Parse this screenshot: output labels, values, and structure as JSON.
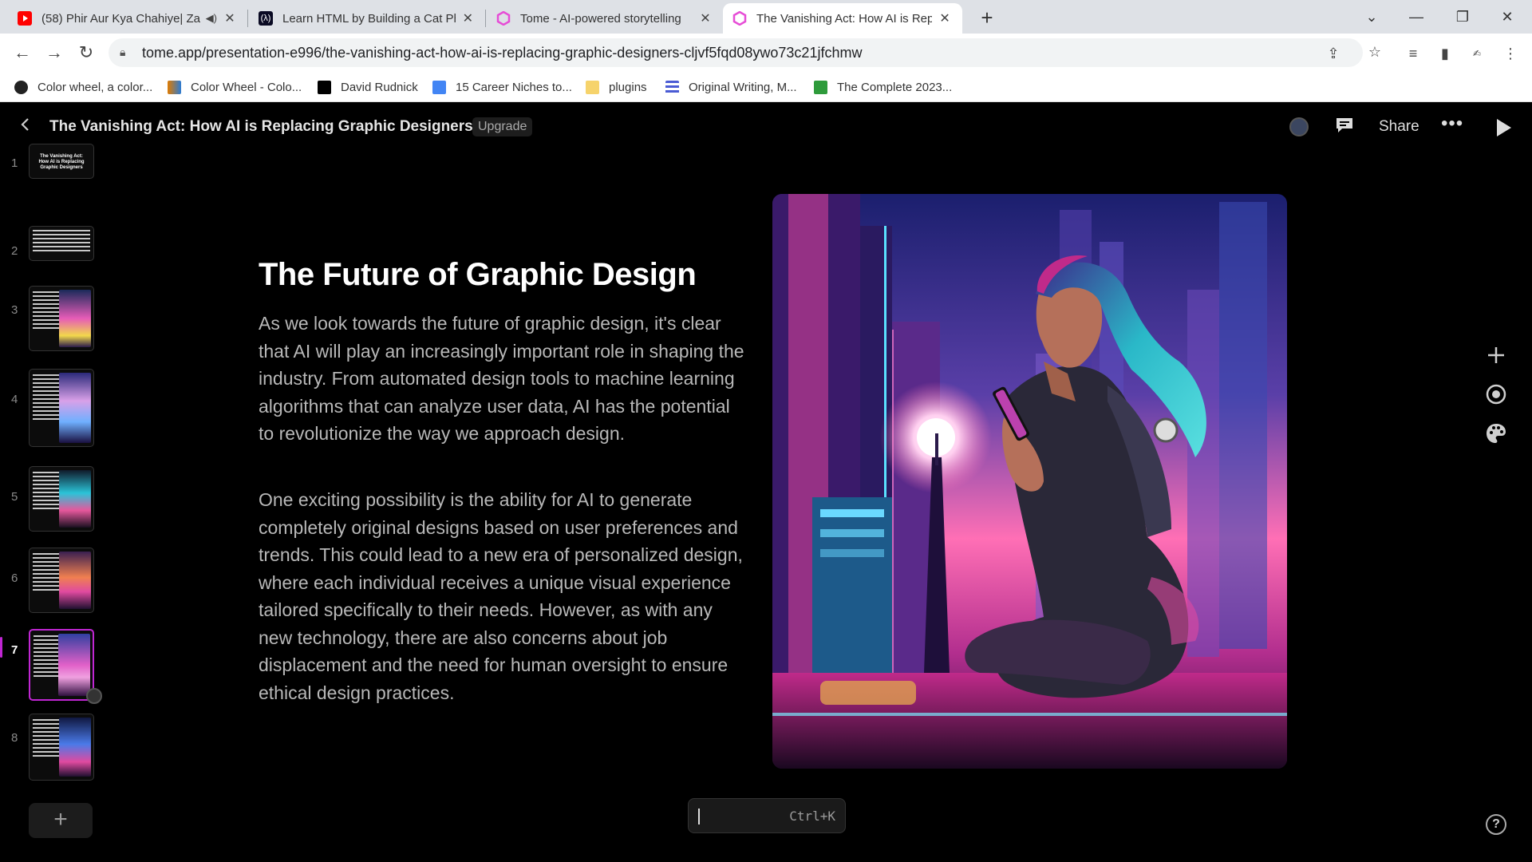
{
  "browser": {
    "tabs": [
      {
        "title": "(58) Phir Aur Kya Chahiye| Za",
        "icon": "youtube-icon",
        "color": "#ff0000",
        "audio": true
      },
      {
        "title": "Learn HTML by Building a Cat Ph",
        "icon": "freecodecamp-icon",
        "color": "#0a0a23"
      },
      {
        "title": "Tome - AI-powered storytelling",
        "icon": "tome-icon",
        "color": "#e64dd6"
      },
      {
        "title": "The Vanishing Act: How AI is Rep",
        "icon": "tome-icon",
        "color": "#e64dd6",
        "active": true
      }
    ],
    "new_tab": "+",
    "url": "tome.app/presentation-e996/the-vanishing-act-how-ai-is-replacing-graphic-designers-cljvf5fqd08ywo73c21jfchmw",
    "bookmarks": [
      {
        "label": "Color wheel, a color...",
        "icon": "colorwheel-icon",
        "color": "#222"
      },
      {
        "label": "Color Wheel - Colo...",
        "icon": "colorwheel2-icon",
        "color": "#e07b00"
      },
      {
        "label": "David Rudnick",
        "icon": "square-icon",
        "color": "#000000"
      },
      {
        "label": "15 Career Niches to...",
        "icon": "docs-icon",
        "color": "#4285f4"
      },
      {
        "label": "plugins",
        "icon": "folder-icon",
        "color": "#f6d36b"
      },
      {
        "label": "Original Writing, M...",
        "icon": "list-icon",
        "color": "#4a5bd4"
      },
      {
        "label": "The Complete 2023...",
        "icon": "fcm-icon",
        "color": "#2e9b3b"
      }
    ]
  },
  "app": {
    "doc_title": "The Vanishing Act: How AI is Replacing Graphic Designers",
    "upgrade_label": "Upgrade",
    "share_label": "Share",
    "accent": "#c026d3"
  },
  "thumbnails": [
    {
      "num": "1",
      "text": "The Vanishing Act: How AI is Replacing Graphic Designers"
    },
    {
      "num": "2"
    },
    {
      "num": "3"
    },
    {
      "num": "4"
    },
    {
      "num": "5"
    },
    {
      "num": "6"
    },
    {
      "num": "7",
      "active": true
    },
    {
      "num": "8"
    }
  ],
  "slide": {
    "title": "The Future of Graphic Design",
    "paragraph_1": "As we look towards the future of graphic design, it's clear that AI will play an increasingly important role in shaping the industry. From automated design tools to machine learning algorithms that can analyze user data, AI has the potential to revolutionize the way we approach design.",
    "paragraph_2": "One exciting possibility is the ability for AI to generate completely original designs based on user preferences and trends. This could lead to a new era of personalized design, where each individual receives a unique visual experience tailored specifically to their needs. However, as with any new technology, there are also concerns about job displacement and the need for human oversight to ensure ethical design practices."
  },
  "command_bar": {
    "shortcut": "Ctrl+K"
  },
  "help_label": "?"
}
